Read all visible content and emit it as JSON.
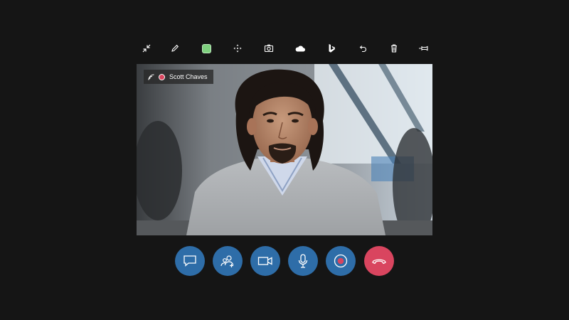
{
  "call": {
    "participant_name": "Scott Chaves",
    "recording": true
  },
  "toolbar": {
    "items": [
      {
        "id": "collapse",
        "icon": "collapse-arrows-icon"
      },
      {
        "id": "pen",
        "icon": "pencil-icon"
      },
      {
        "id": "color",
        "icon": "green-color-swatch",
        "color": "#7ed07e"
      },
      {
        "id": "move",
        "icon": "move-arrows-icon"
      },
      {
        "id": "snapshot",
        "icon": "camera-icon"
      },
      {
        "id": "cloud",
        "icon": "cloud-icon"
      },
      {
        "id": "bing",
        "icon": "bing-logo-icon"
      },
      {
        "id": "undo",
        "icon": "undo-icon"
      },
      {
        "id": "delete",
        "icon": "trash-icon"
      },
      {
        "id": "pin",
        "icon": "pin-icon"
      }
    ]
  },
  "controls": [
    {
      "id": "chat",
      "icon": "chat-bubble-icon"
    },
    {
      "id": "add-people",
      "icon": "add-people-icon"
    },
    {
      "id": "video",
      "icon": "video-camera-icon"
    },
    {
      "id": "mic",
      "icon": "microphone-icon"
    },
    {
      "id": "record",
      "icon": "record-icon"
    },
    {
      "id": "end-call",
      "icon": "hang-up-icon"
    }
  ],
  "colors": {
    "background": "#151515",
    "control_blue": "#2e6da8",
    "end_call_red": "#d9455f",
    "recording_red": "#d9455f"
  }
}
